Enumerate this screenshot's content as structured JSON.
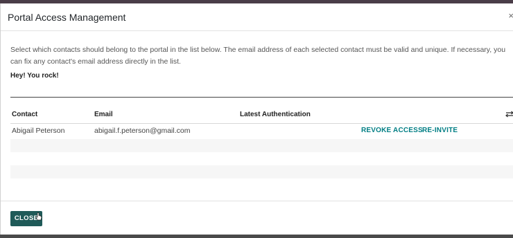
{
  "dialog": {
    "title": "Portal Access Management",
    "close_icon": "close-icon",
    "description": "Select which contacts should belong to the portal in the list below. The email address of each selected contact must be valid and unique. If necessary, you can fix any contact's email address directly in the list.",
    "welcome_message": "Hey! You rock!"
  },
  "table": {
    "headers": {
      "contact": "Contact",
      "email": "Email",
      "latest_auth": "Latest Authentication"
    },
    "settings_icon": "optional-columns-icon",
    "rows": [
      {
        "contact": "Abigail Peterson",
        "email": "abigail.f.peterson@gmail.com",
        "latest_auth": "",
        "revoke_label": "REVOKE ACCESS",
        "reinvite_label": "RE-INVITE"
      }
    ]
  },
  "footer": {
    "close_label": "CLOSE"
  },
  "colors": {
    "primary": "#1f5a58",
    "link": "#017e84"
  }
}
